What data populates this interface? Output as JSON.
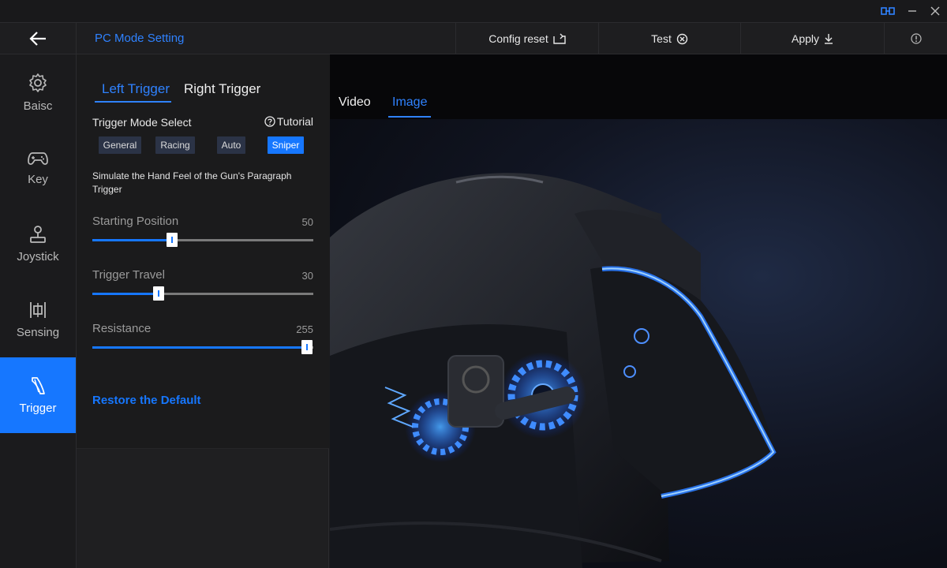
{
  "header": {
    "page_title": "PC Mode Setting",
    "config_reset_label": "Config reset",
    "test_label": "Test",
    "apply_label": "Apply"
  },
  "nav": {
    "items": [
      {
        "label": "Baisc",
        "icon": "gear-icon"
      },
      {
        "label": "Key",
        "icon": "gamepad-icon"
      },
      {
        "label": "Joystick",
        "icon": "joystick-icon"
      },
      {
        "label": "Sensing",
        "icon": "sensing-icon"
      },
      {
        "label": "Trigger",
        "icon": "trigger-icon"
      }
    ],
    "active": "Trigger"
  },
  "trigger_tabs": {
    "left": "Left Trigger",
    "right": "Right Trigger",
    "active": "Left Trigger"
  },
  "mode": {
    "title": "Trigger Mode Select",
    "tutorial": "Tutorial",
    "options": [
      "General",
      "Racing",
      "Auto",
      "Sniper"
    ],
    "selected": "Sniper"
  },
  "description": "Simulate the Hand Feel of the Gun's Paragraph Trigger",
  "sliders": [
    {
      "label": "Starting Position",
      "value": "50",
      "max": 255
    },
    {
      "label": "Trigger Travel",
      "value": "30",
      "max": 255
    },
    {
      "label": "Resistance",
      "value": "255",
      "max": 255
    }
  ],
  "restore_label": "Restore the Default",
  "preview_tabs": {
    "video": "Video",
    "image": "Image",
    "active": "Image"
  },
  "colors": {
    "accent": "#1677ff",
    "accent_text": "#2f82ff",
    "background": "#1b1b1d"
  }
}
